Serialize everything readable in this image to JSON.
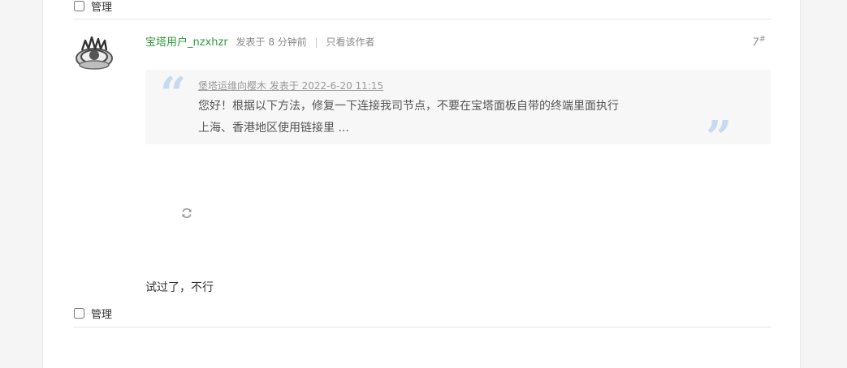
{
  "top_manage": {
    "label": "管理"
  },
  "post": {
    "author": "宝塔用户_nzxhzr",
    "posted_time": "发表于 8 分钟前",
    "separator": "|",
    "only_author_link": "只看该作者",
    "floor_number": "7",
    "floor_mark": "#",
    "quote": {
      "header": "堡塔运维向樱木 发表于 2022-6-20 11:15",
      "line1": "您好！根据以下方法，修复一下连接我司节点，不要在宝塔面板自带的终端里面执行",
      "line2": "上海、香港地区使用链接里 ..."
    },
    "reply_text": "试过了，不行"
  },
  "bottom_manage": {
    "label": "管理"
  },
  "icons": {
    "avatar": "avatar-image",
    "refresh": "refresh-icon"
  },
  "colors": {
    "author_green": "#2f9a3c",
    "quote_mark_blue": "#c8dbee",
    "quote_bg": "#f7f7f7"
  }
}
